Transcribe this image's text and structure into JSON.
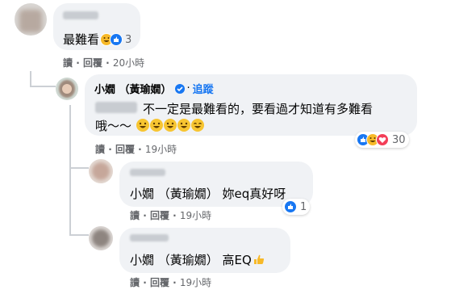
{
  "colors": {
    "bubble": "#f0f2f5",
    "meta_text": "#65676b",
    "follow": "#1877f2",
    "like": "#1877f2",
    "haha": "#f7b928",
    "love": "#f33e58"
  },
  "comments": [
    {
      "text": "最難看",
      "reaction_count": "3",
      "actions": {
        "read": "讀",
        "reply": "回覆",
        "time": "20小時"
      }
    },
    {
      "author": "小嫺 （黃瑜嫺）",
      "follow": "追蹤",
      "text_line1": "不一定是最難看的，要看過才知道有多難看",
      "text_line2": "哦～～",
      "reaction_count": "30",
      "actions": {
        "read": "讀",
        "reply": "回覆",
        "time": "19小時"
      }
    },
    {
      "text": "小嫺 （黃瑜嫺） 妳eq真好呀",
      "reaction_count": "1",
      "actions": {
        "read": "讀",
        "reply": "回覆",
        "time": "19小時"
      }
    },
    {
      "text": "小嫺 （黃瑜嫺） 高EQ",
      "actions": {
        "read": "讀",
        "reply": "回覆",
        "time": "19小時"
      }
    }
  ]
}
